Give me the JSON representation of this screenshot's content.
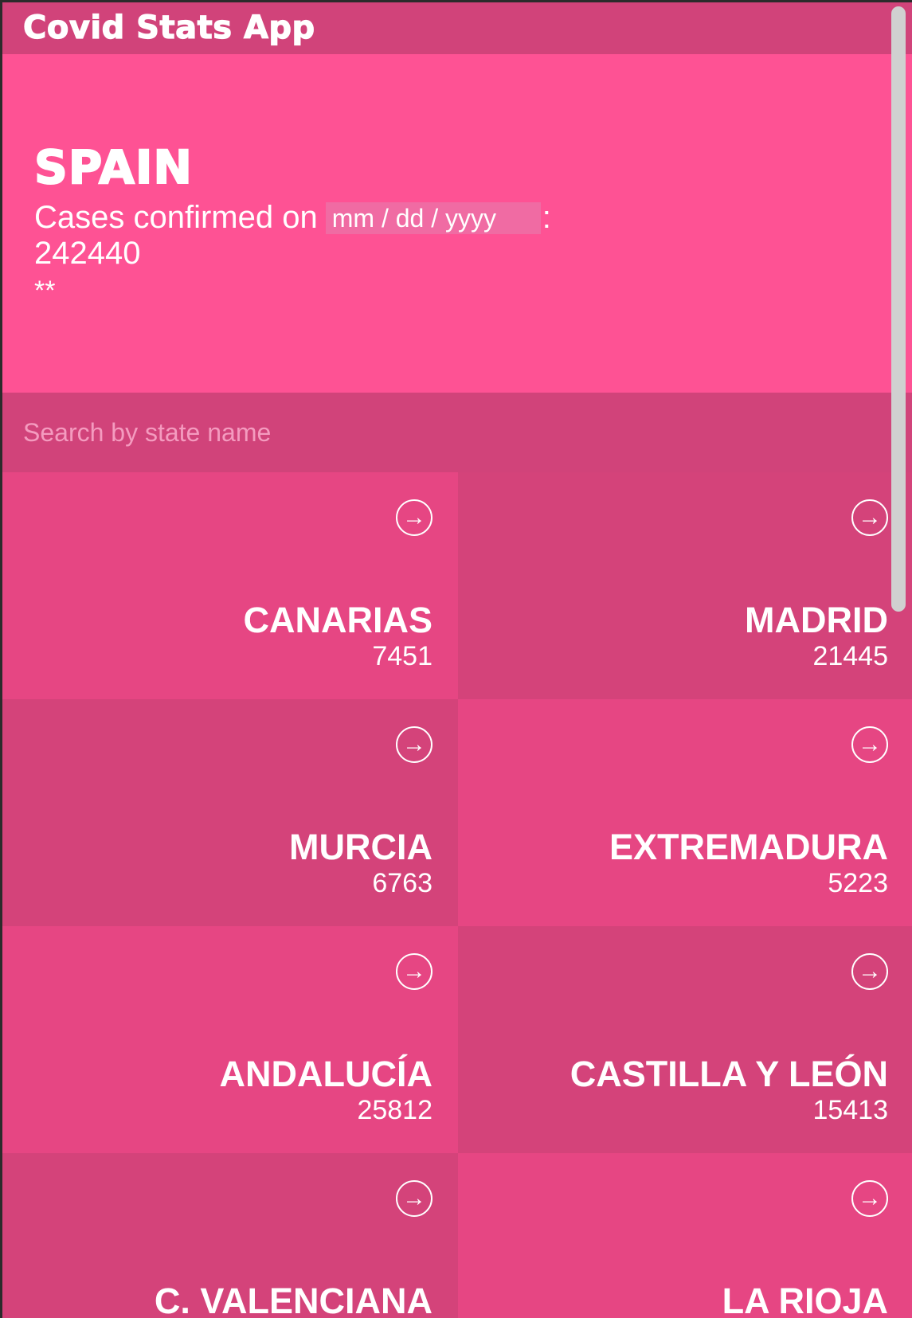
{
  "app": {
    "title": "Covid Stats App"
  },
  "hero": {
    "country": "SPAIN",
    "cases_prefix": "Cases confirmed on",
    "date_placeholder": "mm / dd / yyyy",
    "colon": ":",
    "total_cases": "242440",
    "note": "**"
  },
  "search": {
    "placeholder": "Search by state name"
  },
  "states": [
    {
      "name": "CANARIAS",
      "count": "7451",
      "shade": "light"
    },
    {
      "name": "MADRID",
      "count": "21445",
      "shade": "dark"
    },
    {
      "name": "MURCIA",
      "count": "6763",
      "shade": "dark"
    },
    {
      "name": "EXTREMADURA",
      "count": "5223",
      "shade": "light"
    },
    {
      "name": "ANDALUCÍA",
      "count": "25812",
      "shade": "light"
    },
    {
      "name": "CASTILLA Y LEÓN",
      "count": "15413",
      "shade": "dark"
    },
    {
      "name": "C. VALENCIANA",
      "count": "",
      "shade": "dark"
    },
    {
      "name": "LA RIOJA",
      "count": "",
      "shade": "light"
    }
  ],
  "icons": {
    "open_state": "arrow-right-circle-icon"
  },
  "colors": {
    "header_bg": "#d1437a",
    "hero_bg": "#fe5294",
    "tile_light": "#e64683",
    "tile_dark": "#d4437a",
    "text": "#ffffff"
  }
}
